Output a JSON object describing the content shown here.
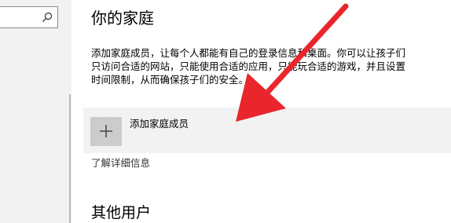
{
  "search": {
    "icon": "search-icon"
  },
  "family": {
    "title": "你的家庭",
    "description": "添加家庭成员，让每个人都能有自己的登录信息和桌面。你可以让孩子们\n只访问合适的网站，只能使用合适的应用，只能玩合适的游戏，并且设置\n时间限制，从而确保孩子们的安全。",
    "add_member_label": "添加家庭成员",
    "add_icon": "plus-icon",
    "learn_more_link": "了解详细信息"
  },
  "other_users": {
    "title": "其他用户"
  },
  "annotation": {
    "color": "#e8262b",
    "icon": "red-arrow-annotation"
  }
}
